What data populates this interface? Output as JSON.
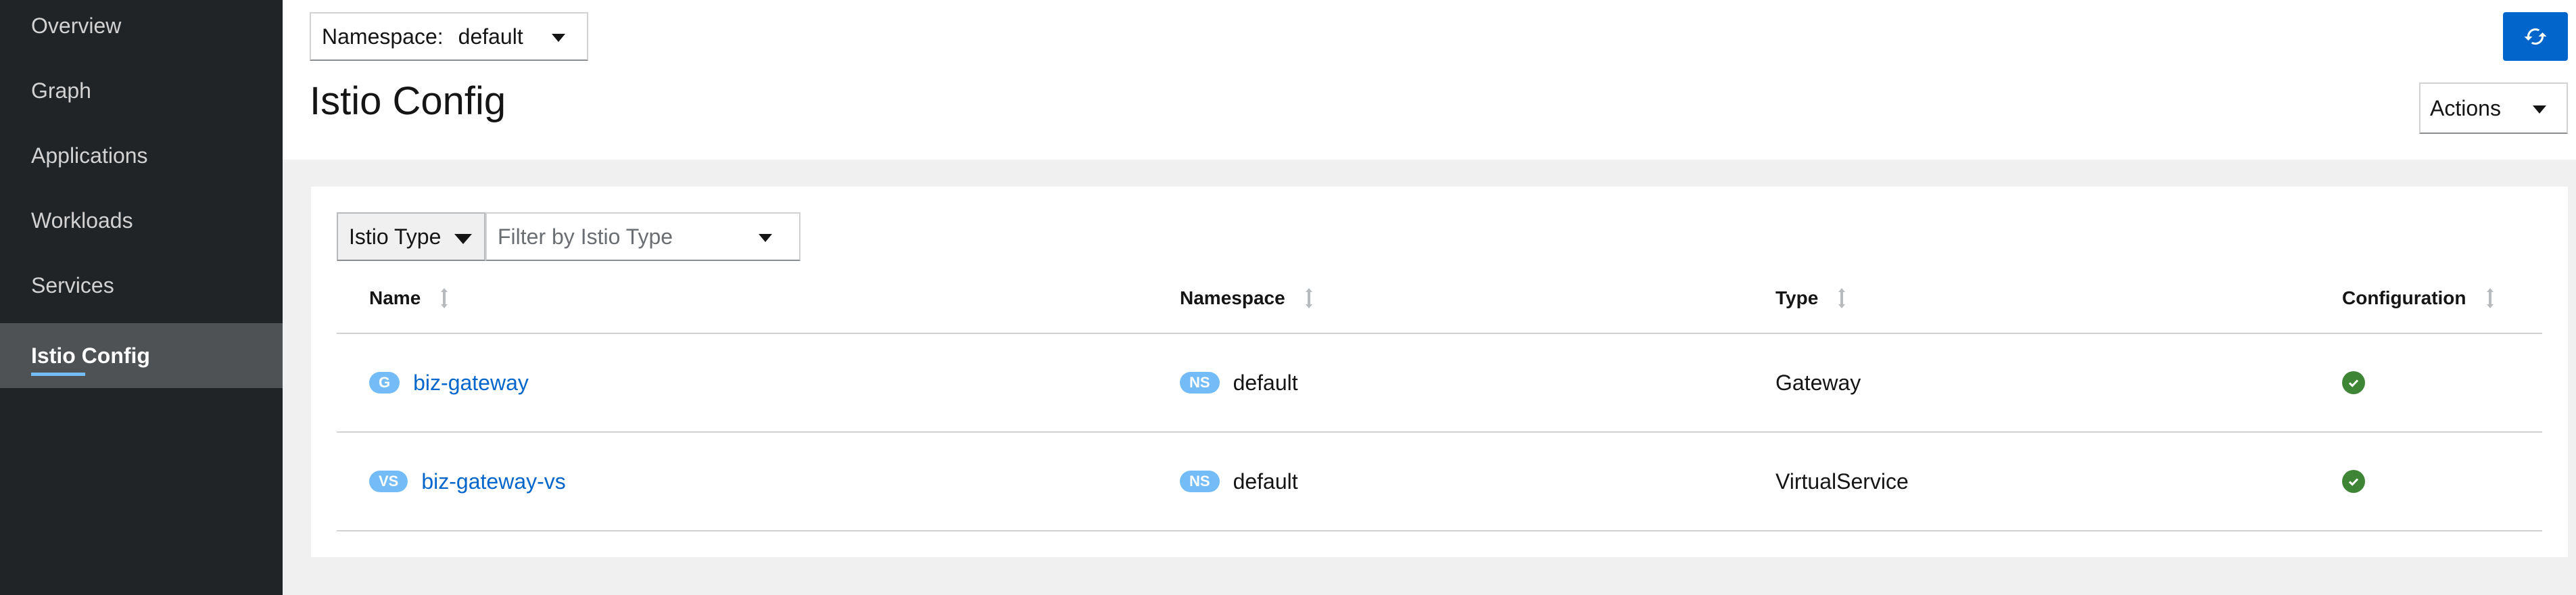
{
  "sidebar": {
    "items": [
      {
        "label": "Overview"
      },
      {
        "label": "Graph"
      },
      {
        "label": "Applications"
      },
      {
        "label": "Workloads"
      },
      {
        "label": "Services"
      },
      {
        "label": "Istio Config"
      }
    ],
    "active": "Istio Config"
  },
  "header": {
    "namespace_label": "Namespace:",
    "namespace_value": "default",
    "title": "Istio Config",
    "actions_label": "Actions",
    "refresh_icon": "sync-icon"
  },
  "filter": {
    "type_label": "Istio Type",
    "placeholder": "Filter by Istio Type"
  },
  "table": {
    "columns": [
      "Name",
      "Namespace",
      "Type",
      "Configuration"
    ],
    "rows": [
      {
        "name_badge": "G",
        "name": "biz-gateway",
        "ns_badge": "NS",
        "namespace": "default",
        "type": "Gateway",
        "config_icon": "check-circle-icon"
      },
      {
        "name_badge": "VS",
        "name": "biz-gateway-vs",
        "ns_badge": "NS",
        "namespace": "default",
        "type": "VirtualService",
        "config_icon": "check-circle-icon"
      }
    ]
  },
  "colors": {
    "sidebar_bg": "#212427",
    "primary": "#0066cc",
    "badge": "#73bcf7",
    "success": "#3e8635"
  }
}
